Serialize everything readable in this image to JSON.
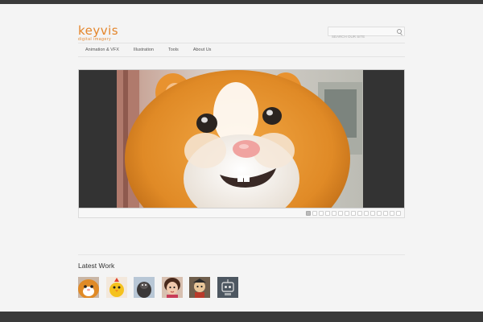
{
  "header": {
    "logo_main": "keyvis",
    "logo_sub": "digital imagery",
    "search_placeholder": "SEARCH OUR SITE"
  },
  "nav": {
    "items": [
      {
        "label": "Animation & VFX"
      },
      {
        "label": "Illustration"
      },
      {
        "label": "Tools"
      },
      {
        "label": "About Us"
      }
    ]
  },
  "slider": {
    "total_slides": 15,
    "active_index": 0
  },
  "latest": {
    "title": "Latest Work",
    "thumbs": [
      "hamster-thumb",
      "chick-thumb",
      "mole-thumb",
      "girl-thumb",
      "character-thumb",
      "robot-thumb"
    ]
  },
  "colors": {
    "accent": "#e4852a",
    "topbar": "#3a3a3a",
    "slider_bg": "#333333"
  }
}
